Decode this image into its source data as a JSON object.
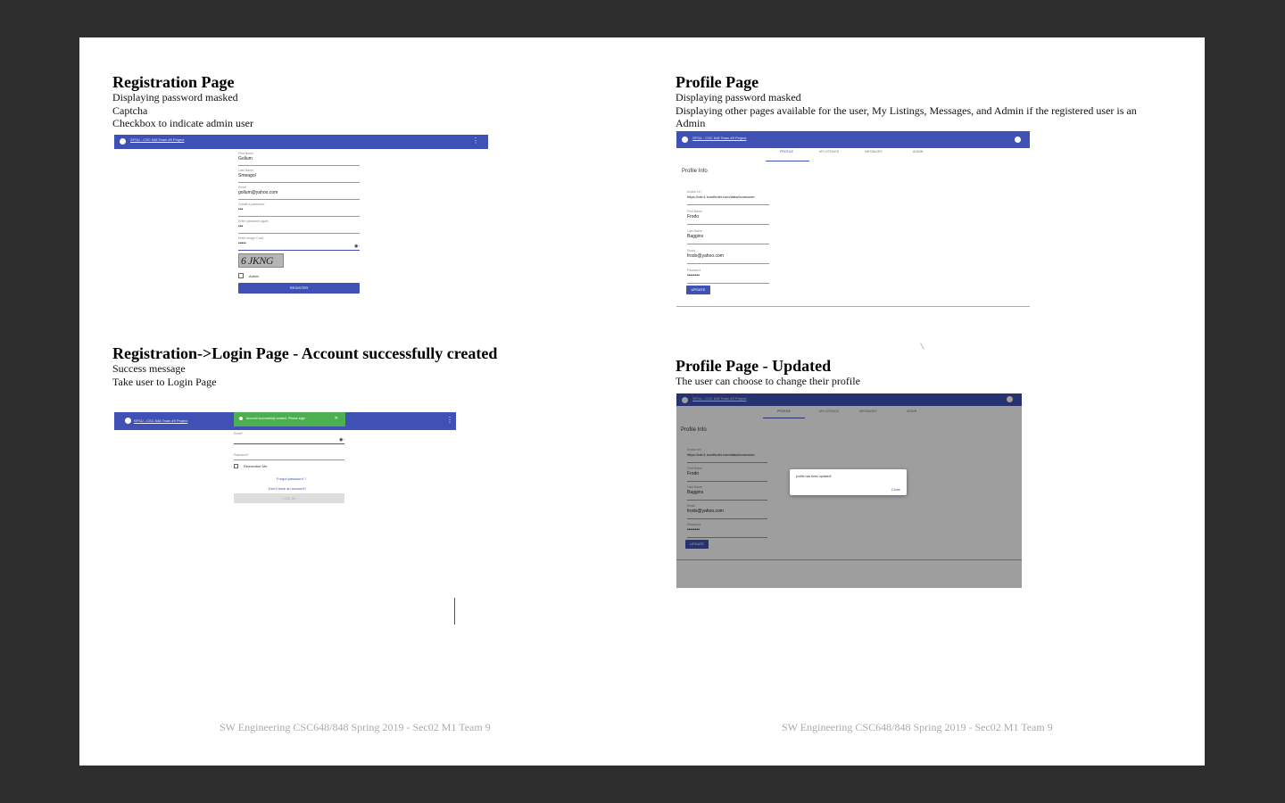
{
  "sections": {
    "reg": {
      "title": "Registration Page",
      "desc": [
        "Displaying password masked",
        "Captcha",
        "Checkbox to indicate admin user"
      ]
    },
    "profile": {
      "title": "Profile Page",
      "desc": [
        "Displaying password masked",
        "Displaying other pages available for the user, My Listings, Messages, and Admin if the registered user is an",
        "Admin"
      ]
    },
    "login": {
      "title": "Registration->Login Page - Account successfully created",
      "desc": [
        "Success message",
        "Take user to Login Page"
      ]
    },
    "updated": {
      "title": "Profile Page - Updated",
      "desc": [
        "The user can choose to change their profile"
      ]
    }
  },
  "footer": {
    "left": "SW Engineering CSC648/848 Spring 2019 - Sec02 M1 Team 9",
    "right": "SW Engineering CSC648/848 Spring 2019 - Sec02 M1 Team 9"
  },
  "app": {
    "brand": "SFSU - CSC 648 Team #9 Project",
    "menu_glyph": "⋮",
    "eye_glyph": "◉-",
    "close_glyph": "✕"
  },
  "registration": {
    "fields": [
      {
        "label": "First Name",
        "value": "Gollum"
      },
      {
        "label": "Last Name",
        "value": "Smeagol"
      },
      {
        "label": "Email",
        "value": "gollum@yahoo.com"
      },
      {
        "label": "Create a password",
        "value": "•••"
      },
      {
        "label": "Enter password again",
        "value": "•••"
      },
      {
        "label": "Enter Image Code",
        "value": "•••••"
      }
    ],
    "captcha": "6 JKNG",
    "admin_label": "Admin",
    "register_label": "REGISTER"
  },
  "login": {
    "toast": "Account successfully created. Please login",
    "email_label": "Email*",
    "password_label": "Password*",
    "remember_label": "Remember Me",
    "forgot": "Forgot password ?",
    "no_account": "Don't have an account?",
    "login_label": "LOG IN"
  },
  "profile": {
    "tabs": [
      "PROFILE",
      "MY LISTINGS",
      "MESSAGES",
      "ADMIN"
    ],
    "page_title": "Profile Info",
    "fields": [
      {
        "label": "Avatar Url",
        "value": "https://cdn1.iconfinder.com/data/icons/user"
      },
      {
        "label": "First Name",
        "value": "Frodo"
      },
      {
        "label": "Last Name",
        "value": "Baggins"
      },
      {
        "label": "Email",
        "value": "frodo@yahoo.com"
      },
      {
        "label": "Password",
        "value": "••••••••"
      }
    ],
    "update_label": "UPDATE"
  },
  "updated": {
    "dialog_text": "profile has been updated!",
    "dialog_close": "Close"
  }
}
